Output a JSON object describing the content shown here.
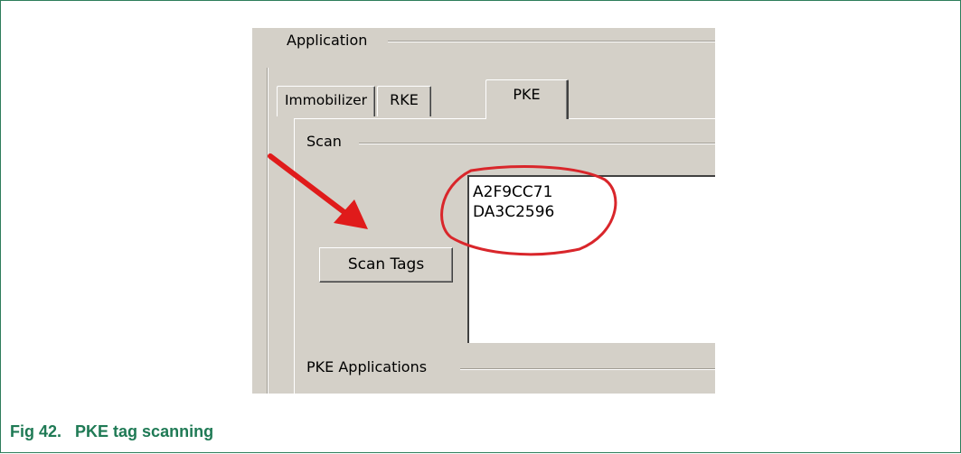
{
  "window": {
    "application_group": "Application",
    "tabs": [
      {
        "label": "Immobilizer",
        "active": false
      },
      {
        "label": "RKE",
        "active": false
      },
      {
        "label": "PKE",
        "active": true
      }
    ],
    "scan_group": "Scan",
    "scan_button": "Scan Tags",
    "tag_list": [
      "A2F9CC71",
      "DA3C2596"
    ],
    "pke_applications_group": "PKE Applications"
  },
  "annotations": {
    "arrow_color": "#e01b1b",
    "highlight_color": "#d9262b",
    "arrow_icon": "arrow-icon"
  },
  "caption": {
    "number": "Fig 42.",
    "title": "PKE tag scanning",
    "color": "#1f7a55"
  }
}
